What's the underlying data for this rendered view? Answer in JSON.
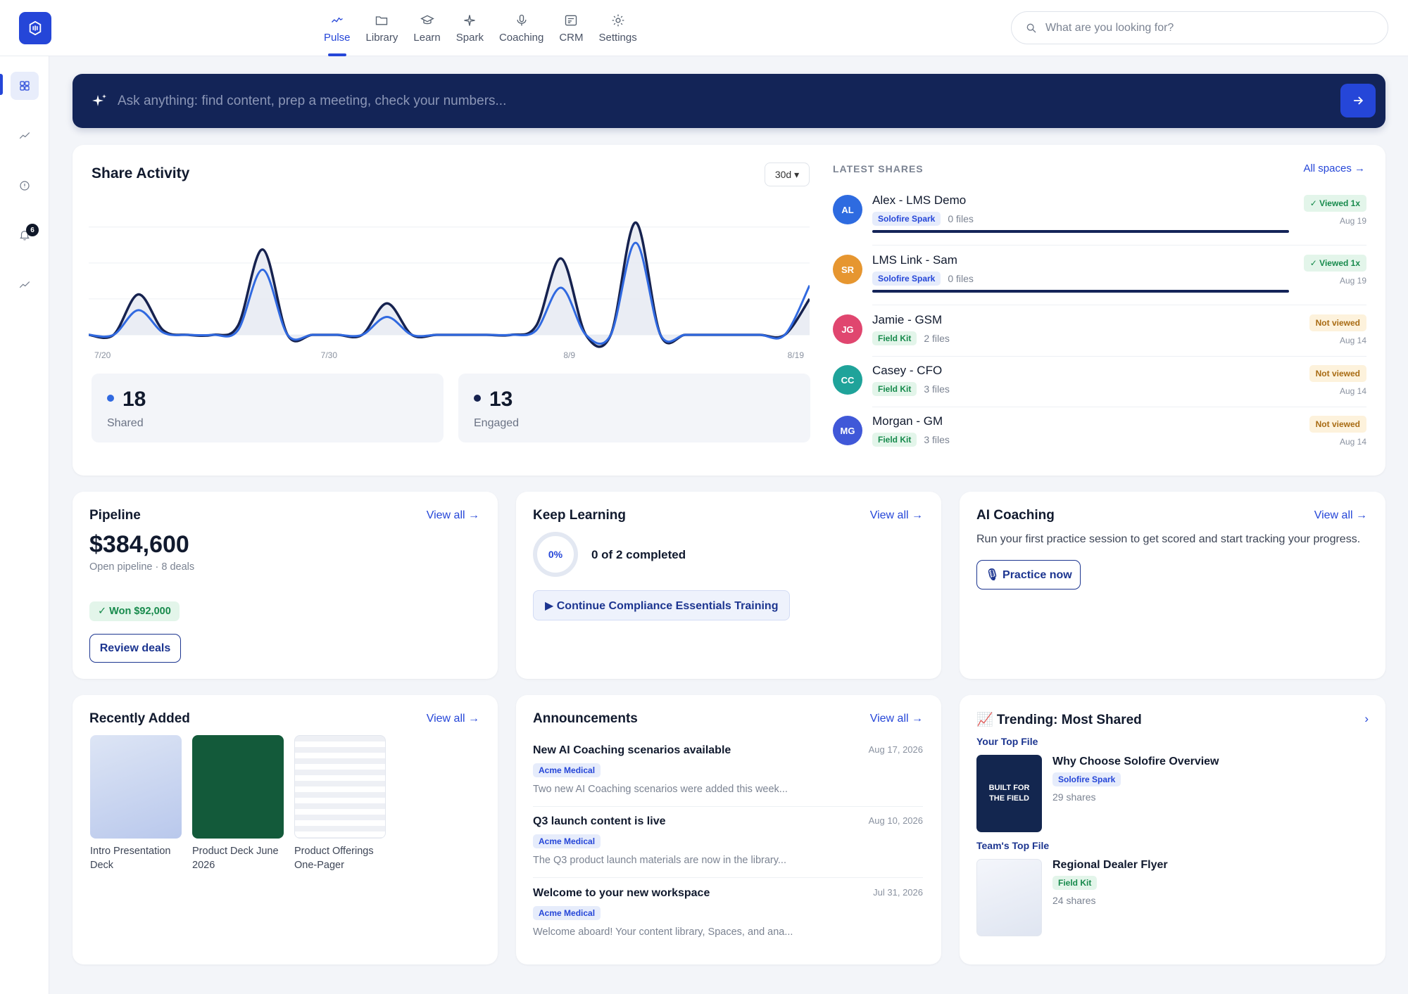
{
  "nav": {
    "items": [
      {
        "label": "Pulse",
        "icon": "pulse-icon"
      },
      {
        "label": "Library",
        "icon": "folder-icon"
      },
      {
        "label": "Learn",
        "icon": "graduation-cap-icon"
      },
      {
        "label": "Spark",
        "icon": "sparkle-icon"
      },
      {
        "label": "Coaching",
        "icon": "microphone-icon"
      },
      {
        "label": "CRM",
        "icon": "crm-card-icon"
      },
      {
        "label": "Settings",
        "icon": "gear-icon"
      }
    ],
    "active": "Pulse"
  },
  "search": {
    "placeholder": "What are you looking for?"
  },
  "sidebar": {
    "notification_count": "6"
  },
  "ask": {
    "placeholder": "Ask anything: find content, prep a meeting, check your numbers..."
  },
  "share_activity": {
    "title": "Share Activity",
    "range": "30d ▾",
    "shared_count": "18",
    "shared_label": "Shared",
    "engaged_count": "13",
    "engaged_label": "Engaged"
  },
  "chart_data": {
    "type": "line",
    "x_tick_labels": [
      "7/20",
      "7/30",
      "8/9",
      "8/19"
    ],
    "series": [
      {
        "color": "#16224f",
        "values": [
          0,
          0,
          0.9,
          0.1,
          0,
          0,
          0.2,
          1.9,
          0,
          0,
          0,
          0,
          0.7,
          0,
          0,
          0,
          0,
          0,
          0.2,
          1.7,
          0,
          0,
          2.5,
          0,
          0,
          0,
          0,
          0,
          0,
          0.8
        ]
      },
      {
        "color": "#3069e0",
        "values": [
          0,
          0,
          0.55,
          0.05,
          0,
          0,
          0.1,
          1.45,
          0,
          0,
          0,
          0,
          0.4,
          0,
          0,
          0,
          0,
          0,
          0.1,
          1.05,
          0,
          0,
          2.05,
          0,
          0,
          0,
          0,
          0,
          0,
          1.1
        ]
      }
    ],
    "colors": {
      "engaged": "#16224f",
      "shared": "#3069e0",
      "fill": "#e5e9f1"
    }
  },
  "latest_shares": {
    "heading": "LATEST SHARES",
    "all_spaces": "All spaces →",
    "rows": [
      {
        "initials": "AL",
        "name": "Alex - LMS Demo",
        "space": "Solofire Spark",
        "files": "0 files",
        "status": "✓ Viewed 1x",
        "date": "Aug 19",
        "color": "#2e6be0"
      },
      {
        "initials": "SR",
        "name": "LMS Link - Sam",
        "space": "Solofire Spark",
        "files": "0 files",
        "status": "✓ Viewed 1x",
        "date": "Aug 19",
        "color": "#e69630"
      },
      {
        "initials": "JG",
        "name": "Jamie - GSM",
        "space": "Field Kit",
        "files": "2 files",
        "status": "Not viewed",
        "date": "Aug 14",
        "color": "#e0466f"
      },
      {
        "initials": "CC",
        "name": "Casey - CFO",
        "space": "Field Kit",
        "files": "3 files",
        "status": "Not viewed",
        "date": "Aug 14",
        "color": "#1fa39a"
      },
      {
        "initials": "MG",
        "name": "Morgan - GM",
        "space": "Field Kit",
        "files": "3 files",
        "status": "Not viewed",
        "date": "Aug 14",
        "color": "#4058d8"
      }
    ]
  },
  "pipeline": {
    "title": "Pipeline",
    "view_all": "View all →",
    "amount": "$384,600",
    "subtitle": "Open pipeline · 8 deals",
    "won": "✓ Won $92,000",
    "button": "Review deals"
  },
  "keep_learning": {
    "title": "Keep Learning",
    "view_all": "View all →",
    "progress_label": "0%",
    "progress": 0,
    "completed": "0 of 2 completed",
    "continue": "▶ Continue Compliance Essentials Training"
  },
  "ai_coaching": {
    "title": "AI Coaching",
    "view_all": "View all →",
    "description": "Run your first practice session to get scored and start tracking your progress.",
    "button": "🎙 Practice now"
  },
  "recently_added": {
    "title": "Recently Added",
    "view_all": "View all →",
    "items": [
      {
        "label": "Intro Presentation Deck"
      },
      {
        "label": "Product Deck June 2026"
      },
      {
        "label": "Product Offerings One-Pager"
      }
    ]
  },
  "announcements": {
    "title": "Announcements",
    "view_all": "View all →",
    "items": [
      {
        "title": "New AI Coaching scenarios available",
        "date": "Aug 17, 2026",
        "tag": "Acme Medical",
        "desc": "Two new AI Coaching scenarios were added this week..."
      },
      {
        "title": "Q3 launch content is live",
        "date": "Aug 10, 2026",
        "tag": "Acme Medical",
        "desc": "The Q3 product launch materials are now in the library..."
      },
      {
        "title": "Welcome to your new workspace",
        "date": "Jul 31, 2026",
        "tag": "Acme Medical",
        "desc": "Welcome aboard! Your content library, Spaces, and ana..."
      }
    ]
  },
  "trending": {
    "title": "📈 Trending: Most Shared",
    "chevron": "›",
    "your_top": "Your Top File",
    "your_file": {
      "name": "Why Choose Solofire Overview",
      "space": "Solofire Spark",
      "shares": "29 shares",
      "cover_text": "BUILT FOR THE FIELD"
    },
    "team_top": "Team's Top File",
    "team_file": {
      "name": "Regional Dealer Flyer",
      "space": "Field Kit",
      "shares": "24 shares"
    }
  }
}
